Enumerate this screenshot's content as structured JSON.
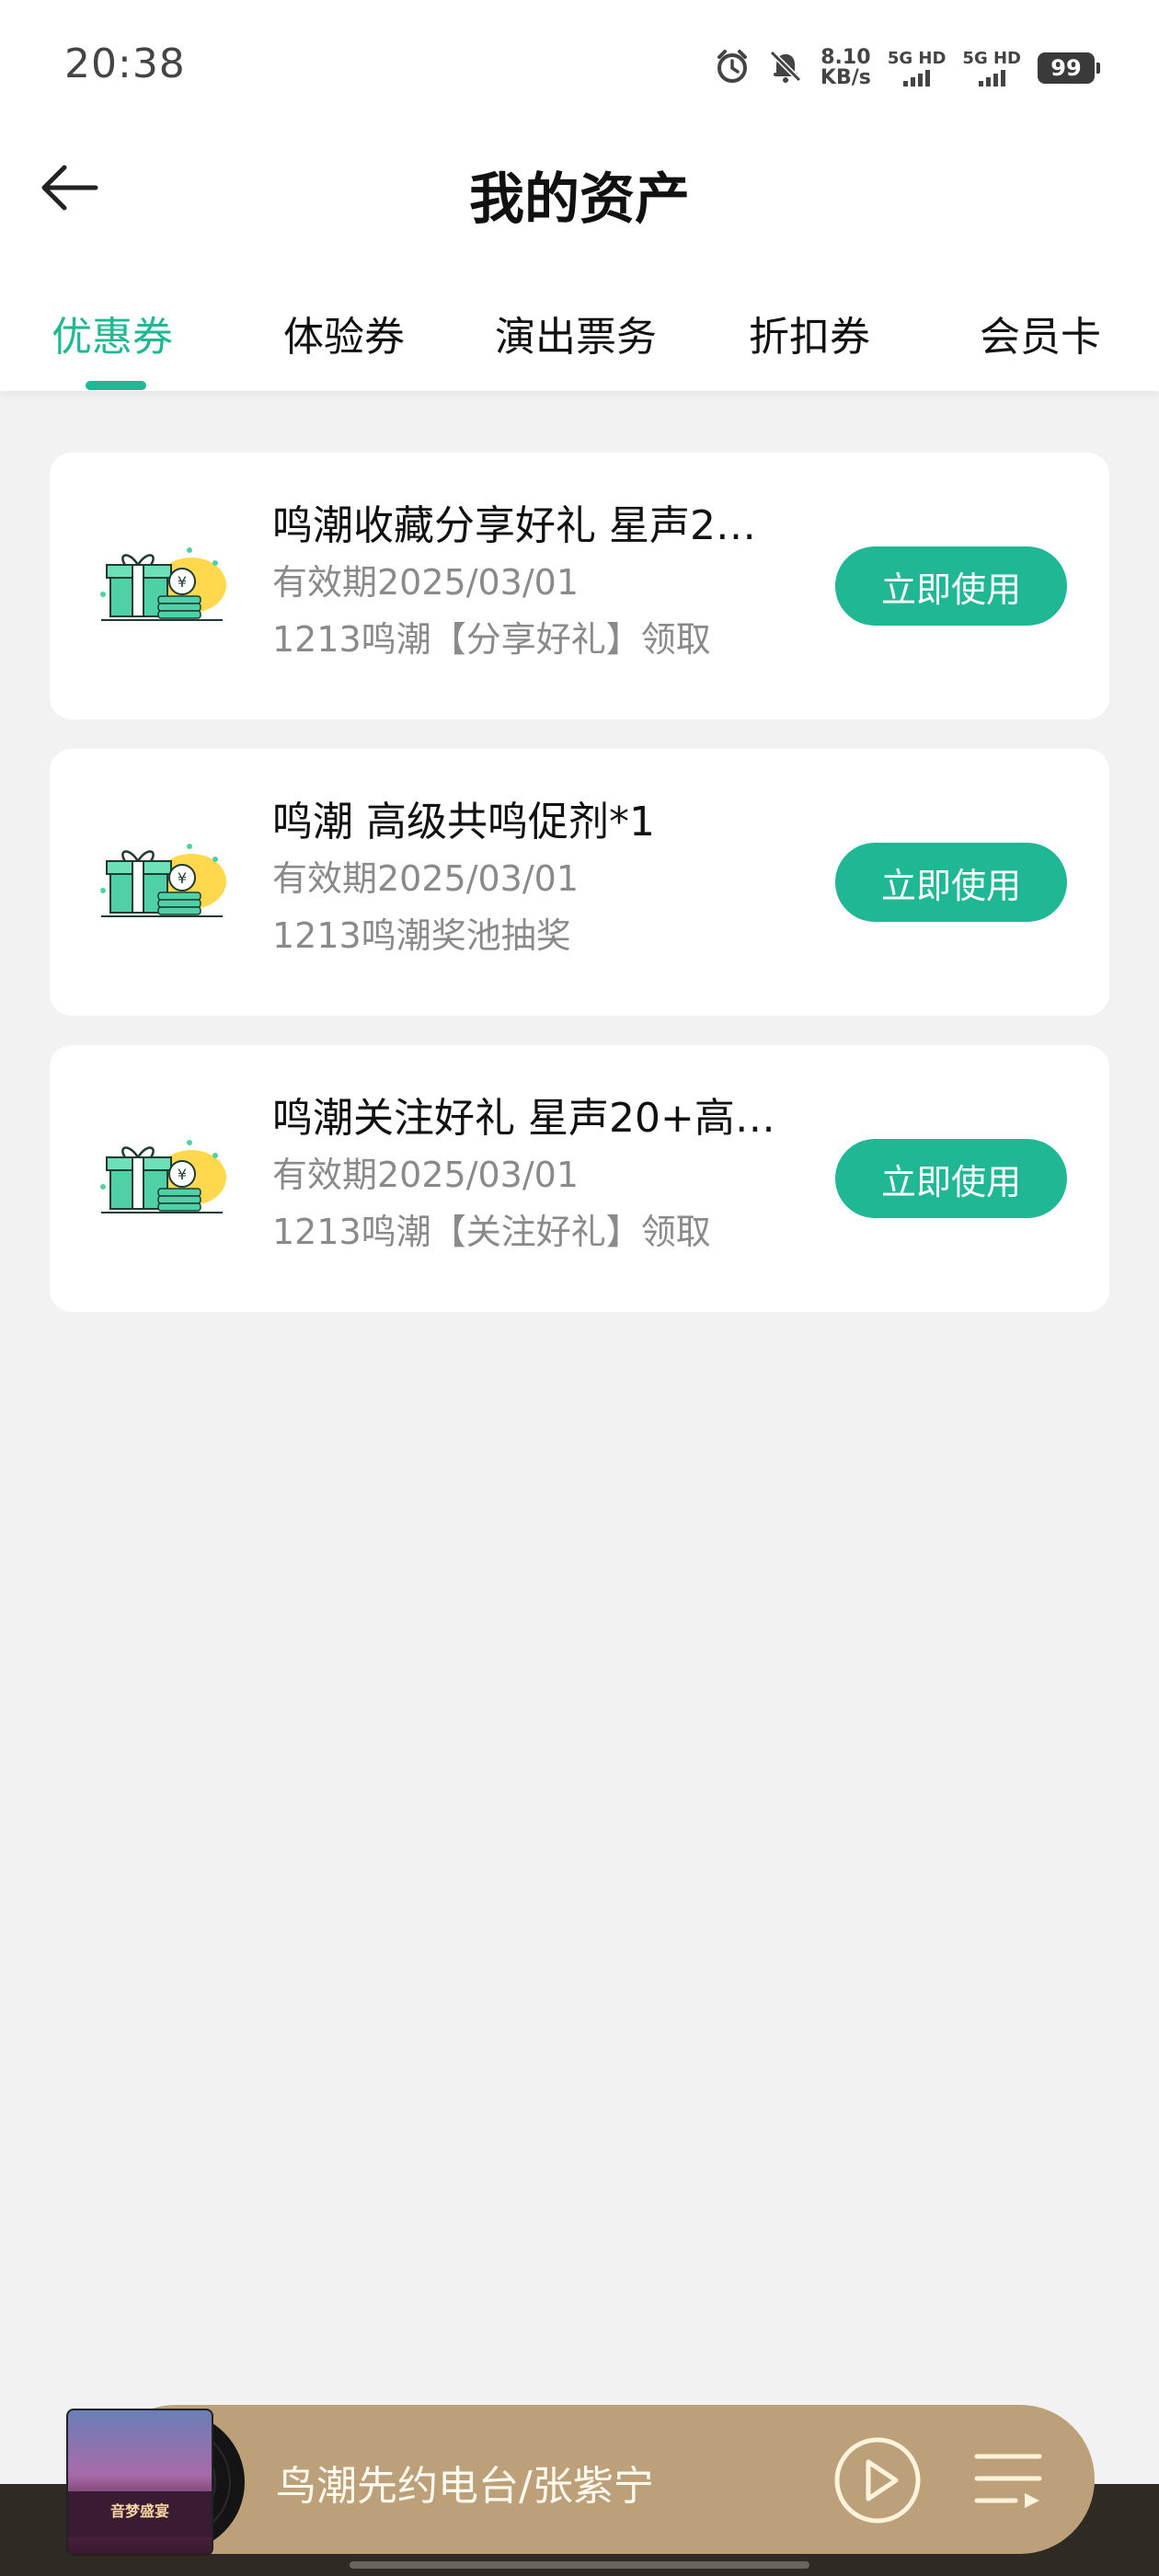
{
  "status_bar": {
    "time": "20:38",
    "net_speed_value": "8.10",
    "net_speed_unit": "KB/s",
    "sim1_label": "5G HD",
    "sim2_label": "5G HD",
    "battery": "99",
    "icons": [
      "alarm-icon",
      "mute-bell-icon",
      "signal-icon",
      "battery-icon"
    ]
  },
  "header": {
    "title": "我的资产"
  },
  "tabs": [
    {
      "label": "优惠券",
      "active": true
    },
    {
      "label": "体验券",
      "active": false
    },
    {
      "label": "演出票务",
      "active": false
    },
    {
      "label": "折扣券",
      "active": false
    },
    {
      "label": "会员卡",
      "active": false
    }
  ],
  "coupons": [
    {
      "title": "鸣潮收藏分享好礼 星声2…",
      "validity": "有效期2025/03/01",
      "source": "1213鸣潮【分享好礼】领取",
      "button": "立即使用"
    },
    {
      "title": "鸣潮 高级共鸣促剂*1",
      "validity": "有效期2025/03/01",
      "source": "1213鸣潮奖池抽奖",
      "button": "立即使用"
    },
    {
      "title": "鸣潮关注好礼 星声20+高…",
      "validity": "有效期2025/03/01",
      "source": "1213鸣潮【关注好礼】领取",
      "button": "立即使用"
    }
  ],
  "player": {
    "track": "鸟潮先约电台/张紫宁",
    "album_art_text": "音梦盛宴"
  },
  "colors": {
    "accent": "#20b894",
    "player_bg": "#bca07a",
    "page_bg": "#f2f2f2"
  }
}
